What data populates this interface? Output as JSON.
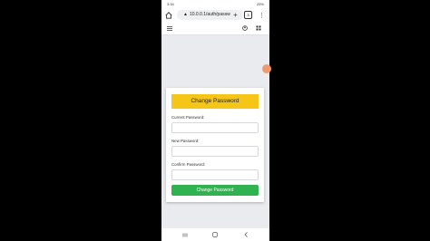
{
  "status_bar": {
    "time": "3:34",
    "right": "25%"
  },
  "browser": {
    "url": "10.0.0.1/auth/passw",
    "tab_count": "3"
  },
  "form": {
    "title": "Change Password",
    "current_label": "Current Password:",
    "new_label": "New Password:",
    "confirm_label": "Confirm Password:",
    "submit_label": "Change Password"
  },
  "colors": {
    "header": "#f5c518",
    "submit": "#2fb24f",
    "page_bg": "#e9ebee"
  }
}
